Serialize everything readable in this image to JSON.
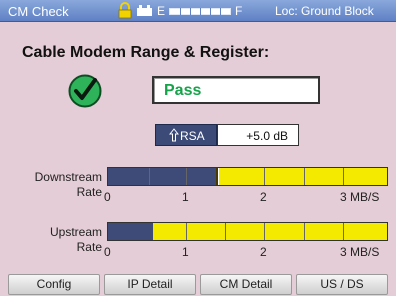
{
  "header": {
    "title": "CM Check",
    "fuel_empty": "E",
    "fuel_full": "F",
    "location": "Loc: Ground Block"
  },
  "main": {
    "heading": "Cable Modem Range & Register:",
    "status": "Pass",
    "rsa_label": "RSA",
    "rsa_value": "+5.0 dB"
  },
  "downstream": {
    "label_line1": "Downstream",
    "label_line2": "Rate",
    "rate_fraction": 0.39,
    "ticks": [
      "0",
      "1",
      "2",
      "3 MB/S"
    ]
  },
  "upstream": {
    "label_line1": "Upstream",
    "label_line2": "Rate",
    "rate_fraction": 0.16,
    "ticks": [
      "0",
      "1",
      "2",
      "3 MB/S"
    ]
  },
  "softkeys": [
    "Config",
    "IP Detail",
    "CM Detail",
    "US / DS"
  ],
  "colors": {
    "header_bg": "#6f8fcf",
    "background": "#e4cdd6",
    "pass_green": "#17a34a",
    "bar_yellow": "#f4ea00",
    "bar_navy": "#3e4a78"
  }
}
